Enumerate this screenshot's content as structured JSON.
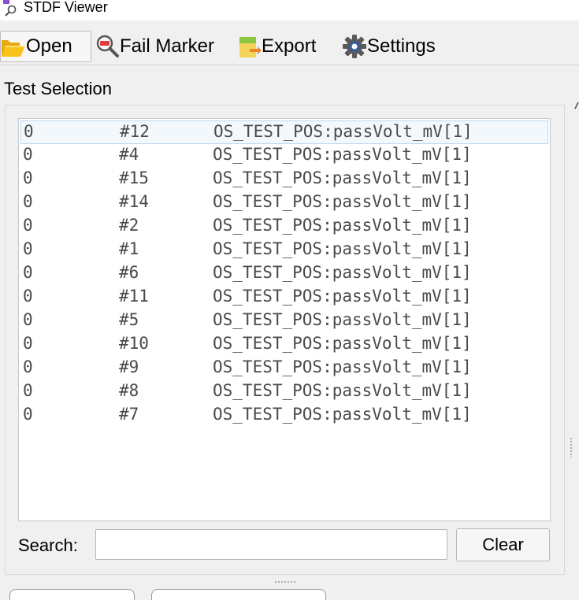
{
  "window": {
    "title": "STDF Viewer"
  },
  "toolbar": {
    "open_label": "Open",
    "fail_marker_label": "Fail Marker",
    "export_label": "Export",
    "settings_label": "Settings"
  },
  "test_selection": {
    "title": "Test Selection",
    "rows": [
      {
        "col1": "0",
        "col2": "#12",
        "col3": "OS_TEST_POS:passVolt_mV[1]"
      },
      {
        "col1": "0",
        "col2": "#4",
        "col3": "OS_TEST_POS:passVolt_mV[1]"
      },
      {
        "col1": "0",
        "col2": "#15",
        "col3": "OS_TEST_POS:passVolt_mV[1]"
      },
      {
        "col1": "0",
        "col2": "#14",
        "col3": "OS_TEST_POS:passVolt_mV[1]"
      },
      {
        "col1": "0",
        "col2": "#2",
        "col3": "OS_TEST_POS:passVolt_mV[1]"
      },
      {
        "col1": "0",
        "col2": "#1",
        "col3": "OS_TEST_POS:passVolt_mV[1]"
      },
      {
        "col1": "0",
        "col2": "#6",
        "col3": "OS_TEST_POS:passVolt_mV[1]"
      },
      {
        "col1": "0",
        "col2": "#11",
        "col3": "OS_TEST_POS:passVolt_mV[1]"
      },
      {
        "col1": "0",
        "col2": "#5",
        "col3": "OS_TEST_POS:passVolt_mV[1]"
      },
      {
        "col1": "0",
        "col2": "#10",
        "col3": "OS_TEST_POS:passVolt_mV[1]"
      },
      {
        "col1": "0",
        "col2": "#9",
        "col3": "OS_TEST_POS:passVolt_mV[1]"
      },
      {
        "col1": "0",
        "col2": "#8",
        "col3": "OS_TEST_POS:passVolt_mV[1]"
      },
      {
        "col1": "0",
        "col2": "#7",
        "col3": "OS_TEST_POS:passVolt_mV[1]"
      }
    ],
    "search_label": "Search:",
    "search_value": "",
    "search_placeholder": "",
    "clear_label": "Clear"
  },
  "icons": {
    "app": "magnifier-app-icon",
    "open": "folder-open-icon",
    "fail_marker": "fail-magnifier-icon",
    "export": "export-document-icon",
    "settings": "gear-icon"
  },
  "colors": {
    "selection_background": "#f3f8fd",
    "selection_border": "#bcd6ee",
    "folder_yellow": "#f7c21a",
    "gear_blue": "#2f5f9f"
  }
}
